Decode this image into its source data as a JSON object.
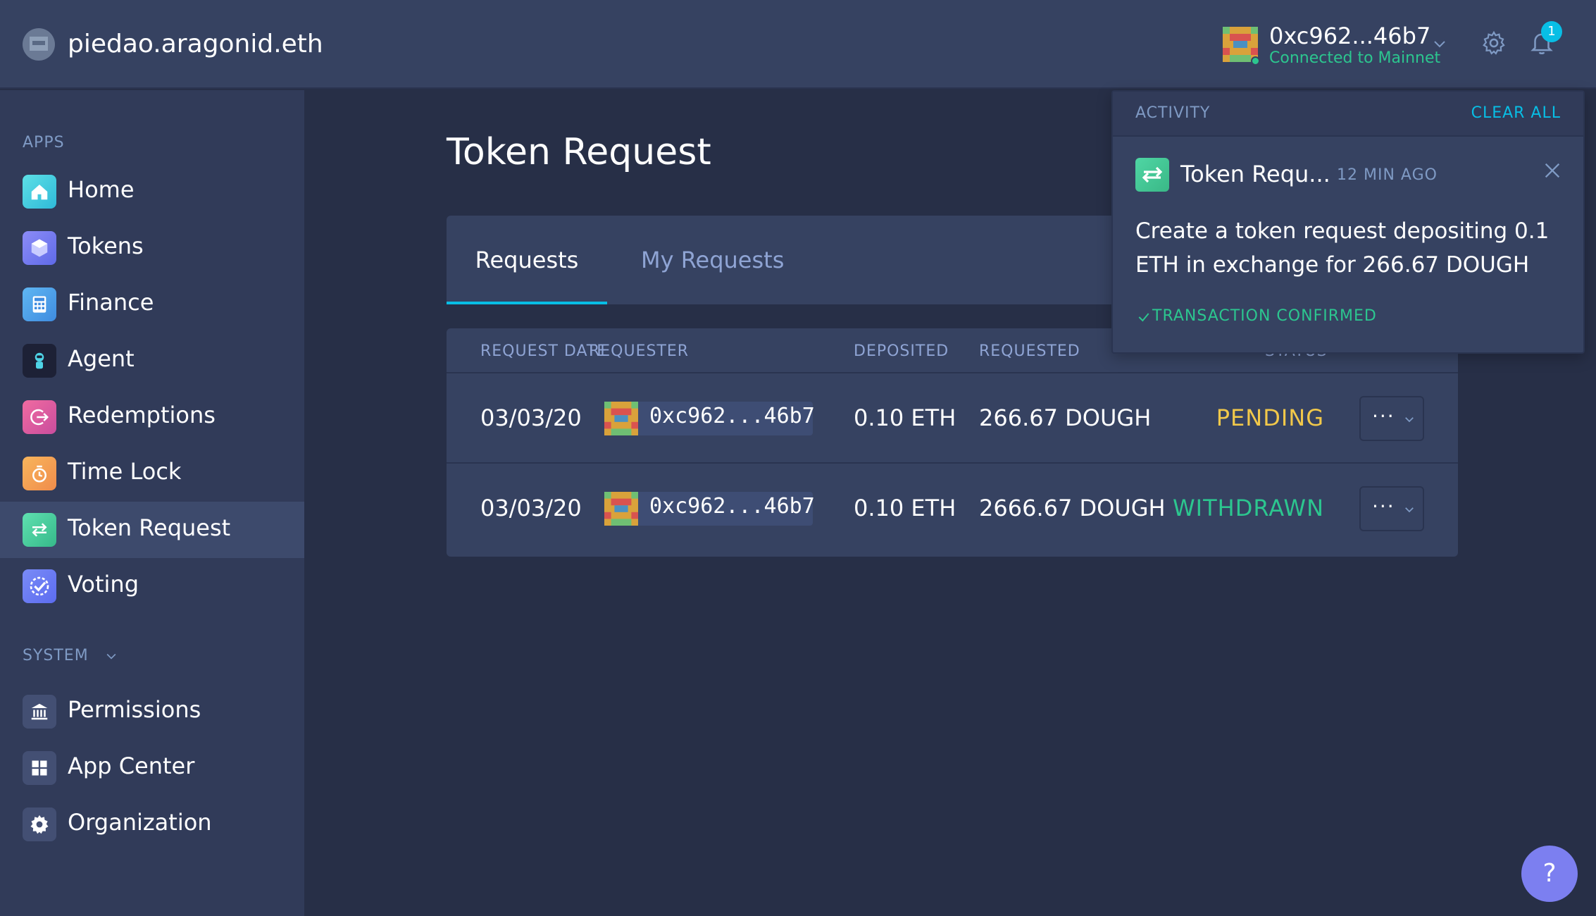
{
  "header": {
    "org_name": "piedao.aragonid.eth",
    "account_address": "0xc962...46b7",
    "account_network": "Connected to Mainnet",
    "notification_count": "1"
  },
  "sidebar": {
    "apps_label": "APPS",
    "system_label": "SYSTEM",
    "apps": [
      {
        "label": "Home",
        "icon": "home-icon"
      },
      {
        "label": "Tokens",
        "icon": "cube-icon"
      },
      {
        "label": "Finance",
        "icon": "calculator-icon"
      },
      {
        "label": "Agent",
        "icon": "robot-icon"
      },
      {
        "label": "Redemptions",
        "icon": "exit-arrow-icon"
      },
      {
        "label": "Time Lock",
        "icon": "clock-lock-icon"
      },
      {
        "label": "Token Request",
        "icon": "exchange-arrows-icon"
      },
      {
        "label": "Voting",
        "icon": "check-seal-icon"
      }
    ],
    "system": [
      {
        "label": "Permissions",
        "icon": "bank-icon"
      },
      {
        "label": "App Center",
        "icon": "grid-icon"
      },
      {
        "label": "Organization",
        "icon": "gear-icon"
      }
    ]
  },
  "main": {
    "title": "Token Request",
    "tabs": [
      "Requests",
      "My Requests"
    ],
    "table": {
      "headers": [
        "REQUEST DATE",
        "REQUESTER",
        "DEPOSITED",
        "REQUESTED",
        "STATUS"
      ],
      "rows": [
        {
          "date": "03/03/20",
          "requester": "0xc962...46b7",
          "deposited": "0.10 ETH",
          "requested": "266.67 DOUGH",
          "status": "PENDING"
        },
        {
          "date": "03/03/20",
          "requester": "0xc962...46b7",
          "deposited": "0.10 ETH",
          "requested": "2666.67 DOUGH",
          "status": "WITHDRAWN"
        }
      ]
    },
    "more_label": "···"
  },
  "activity": {
    "title": "ACTIVITY",
    "clear_all": "CLEAR ALL",
    "item_name": "Token Requ...",
    "item_time": "12 MIN AGO",
    "item_text": "Create a token request depositing 0.1 ETH in exchange for 266.67 DOUGH",
    "item_status": "TRANSACTION CONFIRMED"
  },
  "help_label": "?",
  "colors": {
    "accent": "#08bee5",
    "pending": "#f1c84a",
    "withdrawn": "#2cc68f",
    "confirmed": "#2cc68f"
  }
}
